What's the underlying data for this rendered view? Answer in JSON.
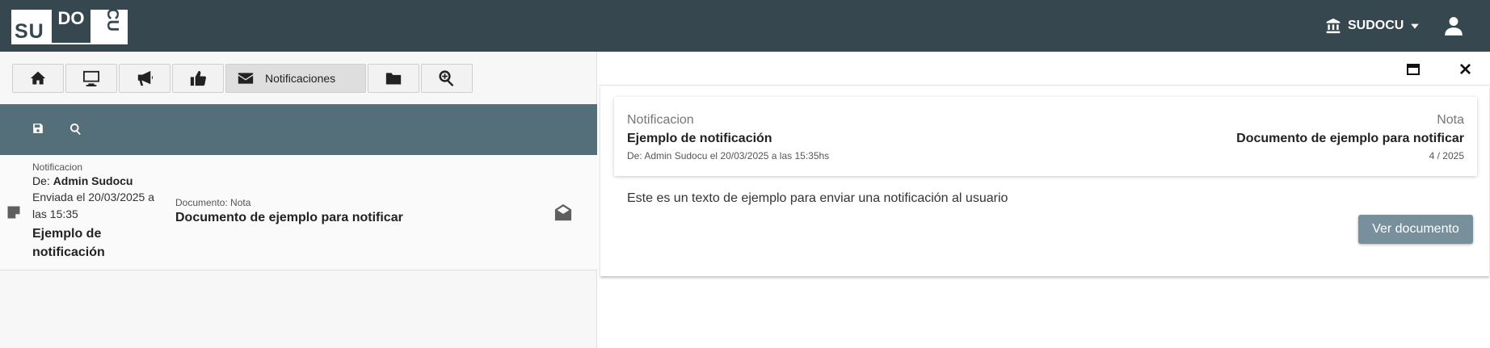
{
  "header": {
    "logo": {
      "text_su": "SU",
      "text_do": "DO",
      "text_cu": "CU"
    },
    "org_name": "SUDOCU",
    "org_icon": "institution-icon",
    "user_icon": "user-icon"
  },
  "toolbar": {
    "buttons": [
      {
        "icon": "home-icon"
      },
      {
        "icon": "desktop-icon"
      },
      {
        "icon": "megaphone-icon"
      },
      {
        "icon": "thumbs-up-icon"
      },
      {
        "icon": "envelope-icon",
        "label": "Notificaciones",
        "active": true
      },
      {
        "icon": "folder-icon"
      },
      {
        "icon": "search-plus-icon"
      }
    ]
  },
  "filterbar": {
    "icons": [
      "save-icon",
      "search-icon"
    ]
  },
  "list": {
    "rows": [
      {
        "type_label": "Notificacion",
        "from_prefix": "De:",
        "from_name": "Admin Sudocu",
        "sent": "Enviada el 20/03/2025 a las 15:35",
        "subject": "Ejemplo de notificación",
        "doc_label": "Documento: Nota",
        "doc_title": "Documento de ejemplo para notificar"
      }
    ]
  },
  "detail": {
    "type_label": "Notificacion",
    "title": "Ejemplo de notificación",
    "meta": "De: Admin Sudocu el 20/03/2025 a las 15:35hs",
    "doc_type": "Nota",
    "doc_title": "Documento de ejemplo para notificar",
    "doc_number": "4 / 2025",
    "body": "Este es un texto de ejemplo para enviar una notificación al usuario",
    "button_label": "Ver documento"
  },
  "colors": {
    "header_bg": "#37474f",
    "filterbar_bg": "#546e7a",
    "button_bg": "#78909c"
  }
}
